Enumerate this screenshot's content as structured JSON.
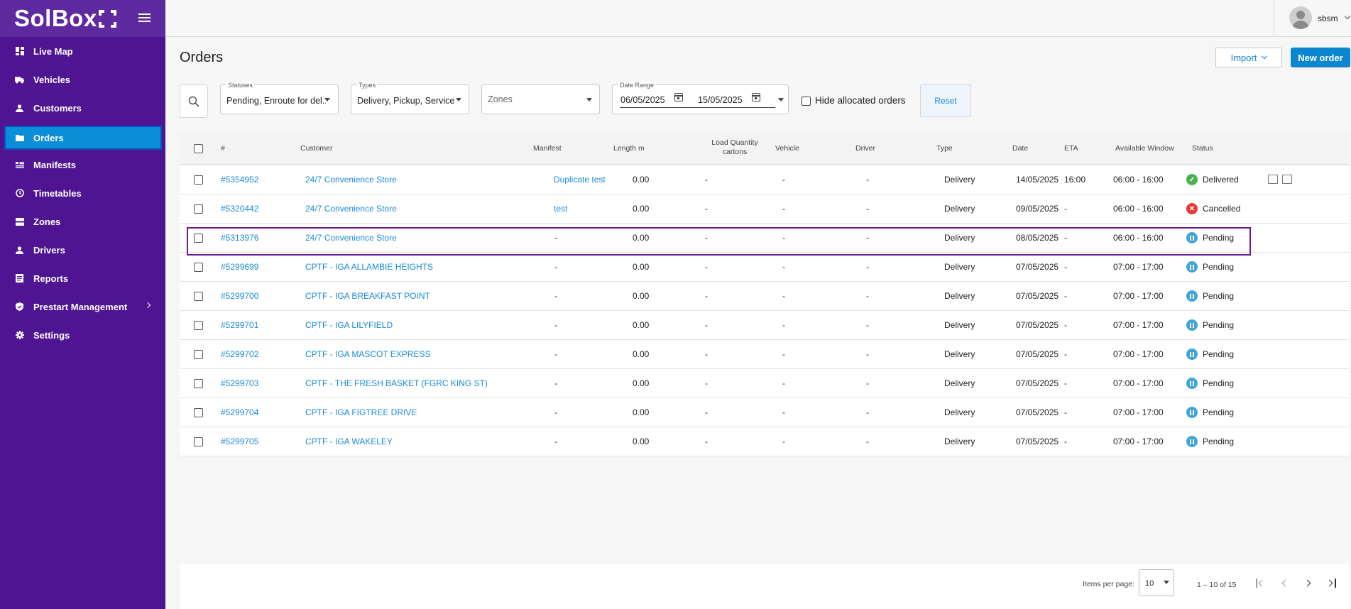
{
  "app": {
    "logo_text": "SolBox"
  },
  "sidebar": {
    "items": [
      {
        "label": "Live Map",
        "icon": "dashboard-icon"
      },
      {
        "label": "Vehicles",
        "icon": "truck-icon"
      },
      {
        "label": "Customers",
        "icon": "person-icon"
      },
      {
        "label": "Orders",
        "icon": "folder-icon",
        "active": true
      },
      {
        "label": "Manifests",
        "icon": "list-icon"
      },
      {
        "label": "Timetables",
        "icon": "clock-icon"
      },
      {
        "label": "Zones",
        "icon": "layers-icon"
      },
      {
        "label": "Drivers",
        "icon": "person-icon"
      },
      {
        "label": "Reports",
        "icon": "report-icon"
      },
      {
        "label": "Prestart Management",
        "icon": "shield-icon",
        "expandable": true
      },
      {
        "label": "Settings",
        "icon": "gear-icon"
      }
    ]
  },
  "topbar": {
    "username": "sbsm"
  },
  "page": {
    "title": "Orders",
    "import_label": "Import",
    "new_order_label": "New order"
  },
  "filters": {
    "statuses": {
      "label": "Statuses",
      "value": "Pending, Enroute for del..."
    },
    "types": {
      "label": "Types",
      "value": "Delivery, Pickup, Service"
    },
    "zones": {
      "placeholder": "Zones"
    },
    "date_range": {
      "label": "Date Range",
      "start": "06/05/2025",
      "end": "15/05/2025"
    },
    "hide_allocated_label": "Hide allocated orders",
    "reset_label": "Reset"
  },
  "table": {
    "headers": {
      "number": "#",
      "customer": "Customer",
      "manifest": "Manifest",
      "length": "Length m",
      "load_qty_1": "Load Quantity",
      "load_qty_2": "cartons",
      "vehicle": "Vehicle",
      "driver": "Driver",
      "type": "Type",
      "date": "Date",
      "eta": "ETA",
      "window": "Available Window",
      "status": "Status"
    },
    "rows": [
      {
        "id": "#5354952",
        "customer": "24/7 Convenience Store",
        "manifest": "Duplicate test",
        "manifest_link": true,
        "length": "0.00",
        "load": "-",
        "vehicle": "-",
        "driver": "-",
        "type": "Delivery",
        "date": "14/05/2025",
        "eta": "16:00",
        "window": "06:00 - 16:00",
        "status": "Delivered",
        "status_color": "#4caf50",
        "attachments": true
      },
      {
        "id": "#5320442",
        "customer": "24/7 Convenience Store",
        "manifest": "test",
        "manifest_link": true,
        "length": "0.00",
        "load": "-",
        "vehicle": "-",
        "driver": "-",
        "type": "Delivery",
        "date": "09/05/2025",
        "eta": "-",
        "window": "06:00 - 16:00",
        "status": "Cancelled",
        "status_color": "#e53935"
      },
      {
        "id": "#5313976",
        "customer": "24/7 Convenience Store",
        "manifest": "-",
        "length": "0.00",
        "load": "-",
        "vehicle": "-",
        "driver": "-",
        "type": "Delivery",
        "date": "08/05/2025",
        "eta": "-",
        "window": "06:00 - 16:00",
        "status": "Pending",
        "status_color": "#42a5d8",
        "highlighted": true
      },
      {
        "id": "#5299699",
        "customer": "CPTF - IGA ALLAMBIE HEIGHTS",
        "manifest": "-",
        "length": "0.00",
        "load": "-",
        "vehicle": "-",
        "driver": "-",
        "type": "Delivery",
        "date": "07/05/2025",
        "eta": "-",
        "window": "07:00 - 17:00",
        "status": "Pending",
        "status_color": "#42a5d8"
      },
      {
        "id": "#5299700",
        "customer": "CPTF - IGA BREAKFAST POINT",
        "manifest": "-",
        "length": "0.00",
        "load": "-",
        "vehicle": "-",
        "driver": "-",
        "type": "Delivery",
        "date": "07/05/2025",
        "eta": "-",
        "window": "07:00 - 17:00",
        "status": "Pending",
        "status_color": "#42a5d8"
      },
      {
        "id": "#5299701",
        "customer": "CPTF - IGA LILYFIELD",
        "manifest": "-",
        "length": "0.00",
        "load": "-",
        "vehicle": "-",
        "driver": "-",
        "type": "Delivery",
        "date": "07/05/2025",
        "eta": "-",
        "window": "07:00 - 17:00",
        "status": "Pending",
        "status_color": "#42a5d8"
      },
      {
        "id": "#5299702",
        "customer": "CPTF - IGA MASCOT EXPRESS",
        "manifest": "-",
        "length": "0.00",
        "load": "-",
        "vehicle": "-",
        "driver": "-",
        "type": "Delivery",
        "date": "07/05/2025",
        "eta": "-",
        "window": "07:00 - 17:00",
        "status": "Pending",
        "status_color": "#42a5d8"
      },
      {
        "id": "#5299703",
        "customer": "CPTF - THE FRESH BASKET (FGRC KING ST)",
        "manifest": "-",
        "length": "0.00",
        "load": "-",
        "vehicle": "-",
        "driver": "-",
        "type": "Delivery",
        "date": "07/05/2025",
        "eta": "-",
        "window": "07:00 - 17:00",
        "status": "Pending",
        "status_color": "#42a5d8"
      },
      {
        "id": "#5299704",
        "customer": "CPTF - IGA FIGTREE DRIVE",
        "manifest": "-",
        "length": "0.00",
        "load": "-",
        "vehicle": "-",
        "driver": "-",
        "type": "Delivery",
        "date": "07/05/2025",
        "eta": "-",
        "window": "07:00 - 17:00",
        "status": "Pending",
        "status_color": "#42a5d8"
      },
      {
        "id": "#5299705",
        "customer": "CPTF - IGA WAKELEY",
        "manifest": "-",
        "length": "0.00",
        "load": "-",
        "vehicle": "-",
        "driver": "-",
        "type": "Delivery",
        "date": "07/05/2025",
        "eta": "-",
        "window": "07:00 - 17:00",
        "status": "Pending",
        "status_color": "#42a5d8"
      }
    ]
  },
  "pagination": {
    "items_per_page_label": "Items per page:",
    "items_per_page": "10",
    "range": "1 – 10 of 15"
  },
  "colors": {
    "sidebar": "#4e1492",
    "accent": "#0b87d1",
    "highlight_border": "#6b1a8f"
  }
}
